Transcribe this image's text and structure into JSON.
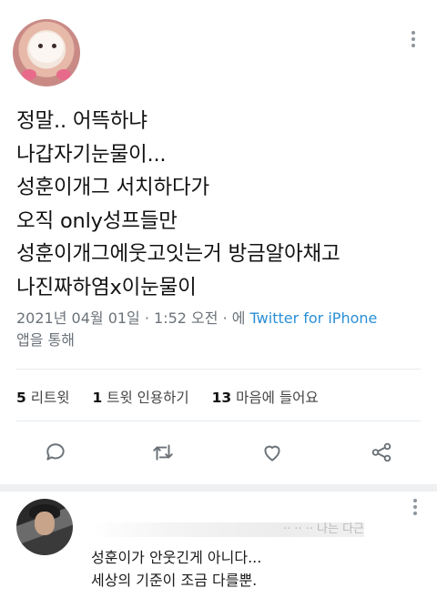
{
  "tweet": {
    "lines": [
      "정말.. 어뜩하냐",
      "나갑자기눈물이...",
      "성훈이개그 서치하다가",
      "오직 only성프들만",
      "성훈이개그에웃고잇는거 방금알아채고",
      "나진짜하염x이눈물이"
    ],
    "timestamp": "2021년 04월 01일 · 1:52 오전 · 에 ",
    "source": "Twitter for iPhone",
    "source_suffix": "앱을 통해"
  },
  "stats": {
    "retweets_count": "5",
    "retweets_label": "리트윗",
    "quotes_count": "1",
    "quotes_label": "트윗 인용하기",
    "likes_count": "13",
    "likes_label": "마음에 들어요"
  },
  "actions": {
    "reply_icon": "comment-icon",
    "retweet_icon": "retweet-icon",
    "like_icon": "heart-icon",
    "share_icon": "share-icon"
  },
  "reply": {
    "obscured_text": "·· ·· ·· 나는 다근",
    "lines": [
      "성훈이가 안웃긴게 아니다...",
      "세상의 기준이 조금 다를뿐."
    ]
  },
  "colors": {
    "link": "#2a8fd6",
    "icon": "#6b7278"
  }
}
